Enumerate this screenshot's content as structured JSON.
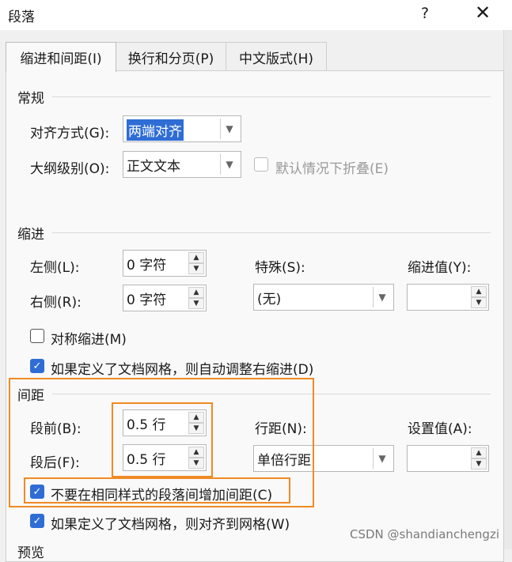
{
  "window": {
    "title": "段落",
    "help": "?",
    "close": "✕"
  },
  "tabs": [
    {
      "label": "缩进和间距(I)",
      "active": true
    },
    {
      "label": "换行和分页(P)",
      "active": false
    },
    {
      "label": "中文版式(H)",
      "active": false
    }
  ],
  "general": {
    "heading": "常规",
    "alignment_label": "对齐方式(G):",
    "alignment_value": "两端对齐",
    "outline_label": "大纲级别(O):",
    "outline_value": "正文文本",
    "collapse_label": "默认情况下折叠(E)"
  },
  "indent": {
    "heading": "缩进",
    "left_label": "左侧(L):",
    "left_value": "0 字符",
    "right_label": "右侧(R):",
    "right_value": "0 字符",
    "special_label": "特殊(S):",
    "special_value": "(无)",
    "by_label": "缩进值(Y):",
    "by_value": "",
    "mirror_label": "对称缩进(M)",
    "auto_adjust_label": "如果定义了文档网格，则自动调整右缩进(D)"
  },
  "spacing": {
    "heading": "间距",
    "before_label": "段前(B):",
    "before_value": "0.5 行",
    "after_label": "段后(F):",
    "after_value": "0.5 行",
    "line_label": "行距(N):",
    "line_value": "单倍行距",
    "at_label": "设置值(A):",
    "at_value": "",
    "no_space_same_style_label": "不要在相同样式的段落间增加间距(C)",
    "snap_grid_label": "如果定义了文档网格，则对齐到网格(W)"
  },
  "preview": {
    "heading": "预览"
  },
  "watermark": "CSDN @shandianchengzi",
  "colors": {
    "highlight": "#f08a24",
    "accent": "#2f6dd5"
  }
}
